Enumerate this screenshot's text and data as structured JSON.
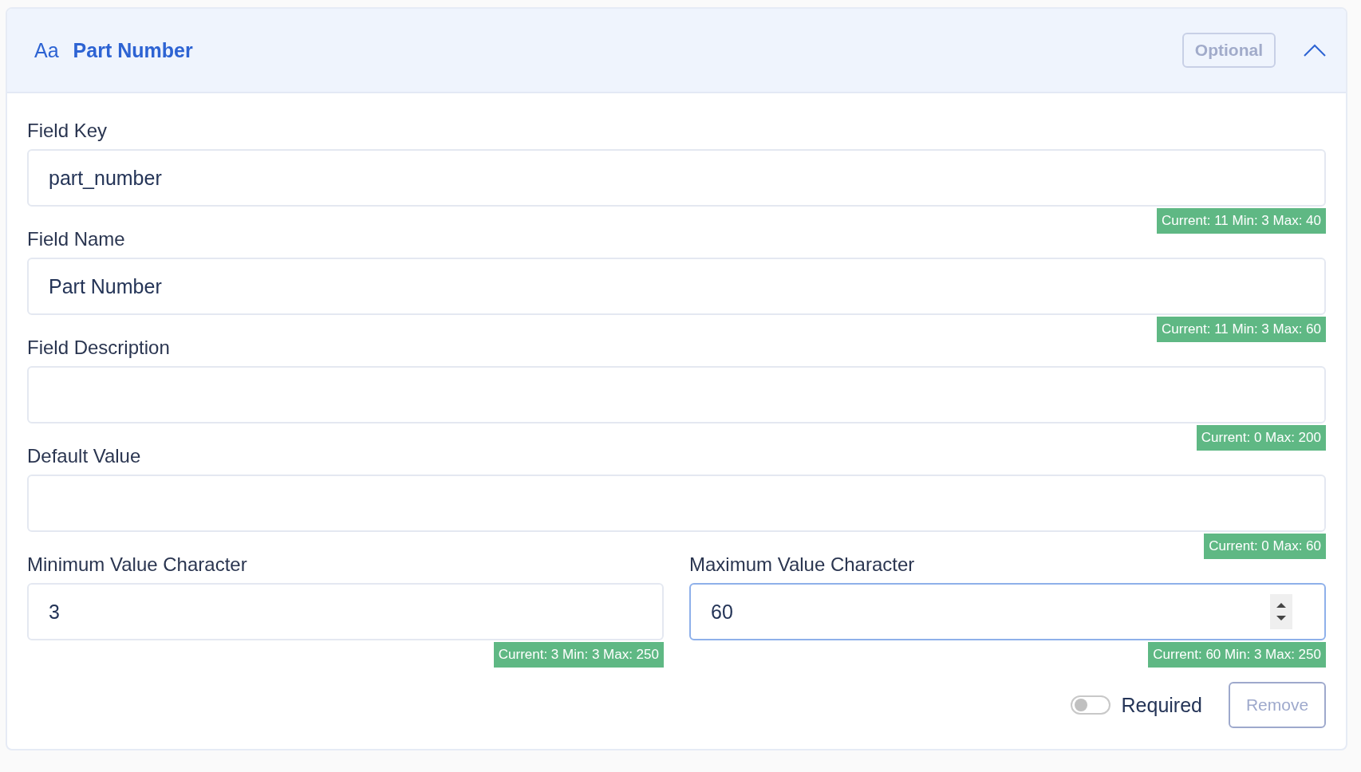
{
  "header": {
    "icon_text": "Aa",
    "title": "Part Number",
    "badge": "Optional",
    "expanded": true
  },
  "fields": [
    {
      "label": "Field Key",
      "value": "part_number",
      "counter": "Current: 11 Min: 3 Max: 40",
      "focused": false
    },
    {
      "label": "Field Name",
      "value": "Part Number",
      "counter": "Current: 11 Min: 3 Max: 60",
      "focused": false
    },
    {
      "label": "Field Description",
      "counter": "Current: 0 Max: 200",
      "focused": false
    },
    {
      "label": "Default Value",
      "counter": "Current: 0 Max: 60",
      "focused": false
    }
  ],
  "limits": [
    {
      "label": "Minimum Value Character",
      "value": "3",
      "counter": "Current: 3 Min: 3 Max: 250",
      "focused": false
    },
    {
      "label": "Maximum Value Character",
      "value": "60",
      "counter": "Current: 60 Min: 3 Max: 250",
      "focused": true
    }
  ],
  "footer": {
    "toggle_label": "Required",
    "required": false,
    "remove": "Remove"
  }
}
